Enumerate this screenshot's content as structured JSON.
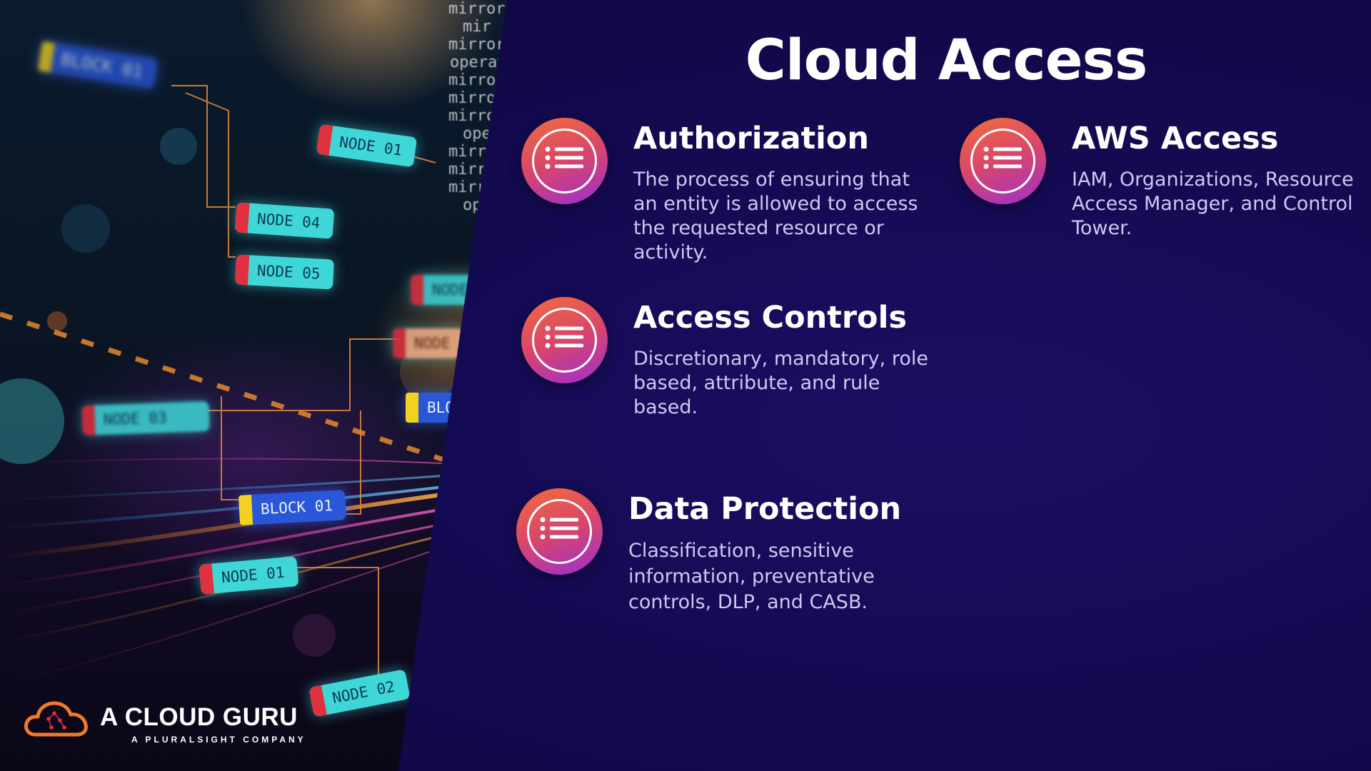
{
  "slide": {
    "title": "Cloud Access",
    "accent_gradient": [
      "#f26d3b",
      "#d8456c",
      "#9b2fd2"
    ],
    "background": "#14094a",
    "items": [
      {
        "heading": "Authorization",
        "icon": "list-icon",
        "lines": [
          "The process of ensuring that",
          "an entity is allowed to access",
          "the requested resource or",
          "activity."
        ]
      },
      {
        "heading": "AWS Access",
        "icon": "list-icon",
        "lines": [
          "IAM, Organizations, Resource",
          "Access Manager, and Control",
          "Tower."
        ]
      },
      {
        "heading": "Access Controls",
        "icon": "list-icon",
        "lines": [
          "Discretionary, mandatory, role",
          "based, attribute, and rule",
          "based."
        ]
      },
      {
        "heading": "Data Protection",
        "icon": "list-icon",
        "lines": [
          "Classification, sensitive",
          "information, preventative",
          "controls, DLP, and CASB."
        ]
      }
    ]
  },
  "illustration": {
    "nodes": [
      "BLOCK 01",
      "NODE 01",
      "NODE 04",
      "NODE 05",
      "NODE",
      "NODE",
      "NODE 03",
      "BLOC",
      "BLOCK 01",
      "NODE 01",
      "NODE 02"
    ],
    "code_lines": [
      "mirror_",
      "mir",
      "mirror",
      "operat",
      "mirro",
      "mirro",
      "mirro",
      "ope",
      "mirr",
      "mirr",
      "mirr",
      "op"
    ]
  },
  "logo": {
    "name": "A CLOUD GURU",
    "tagline": "A PLURALSIGHT COMPANY"
  }
}
